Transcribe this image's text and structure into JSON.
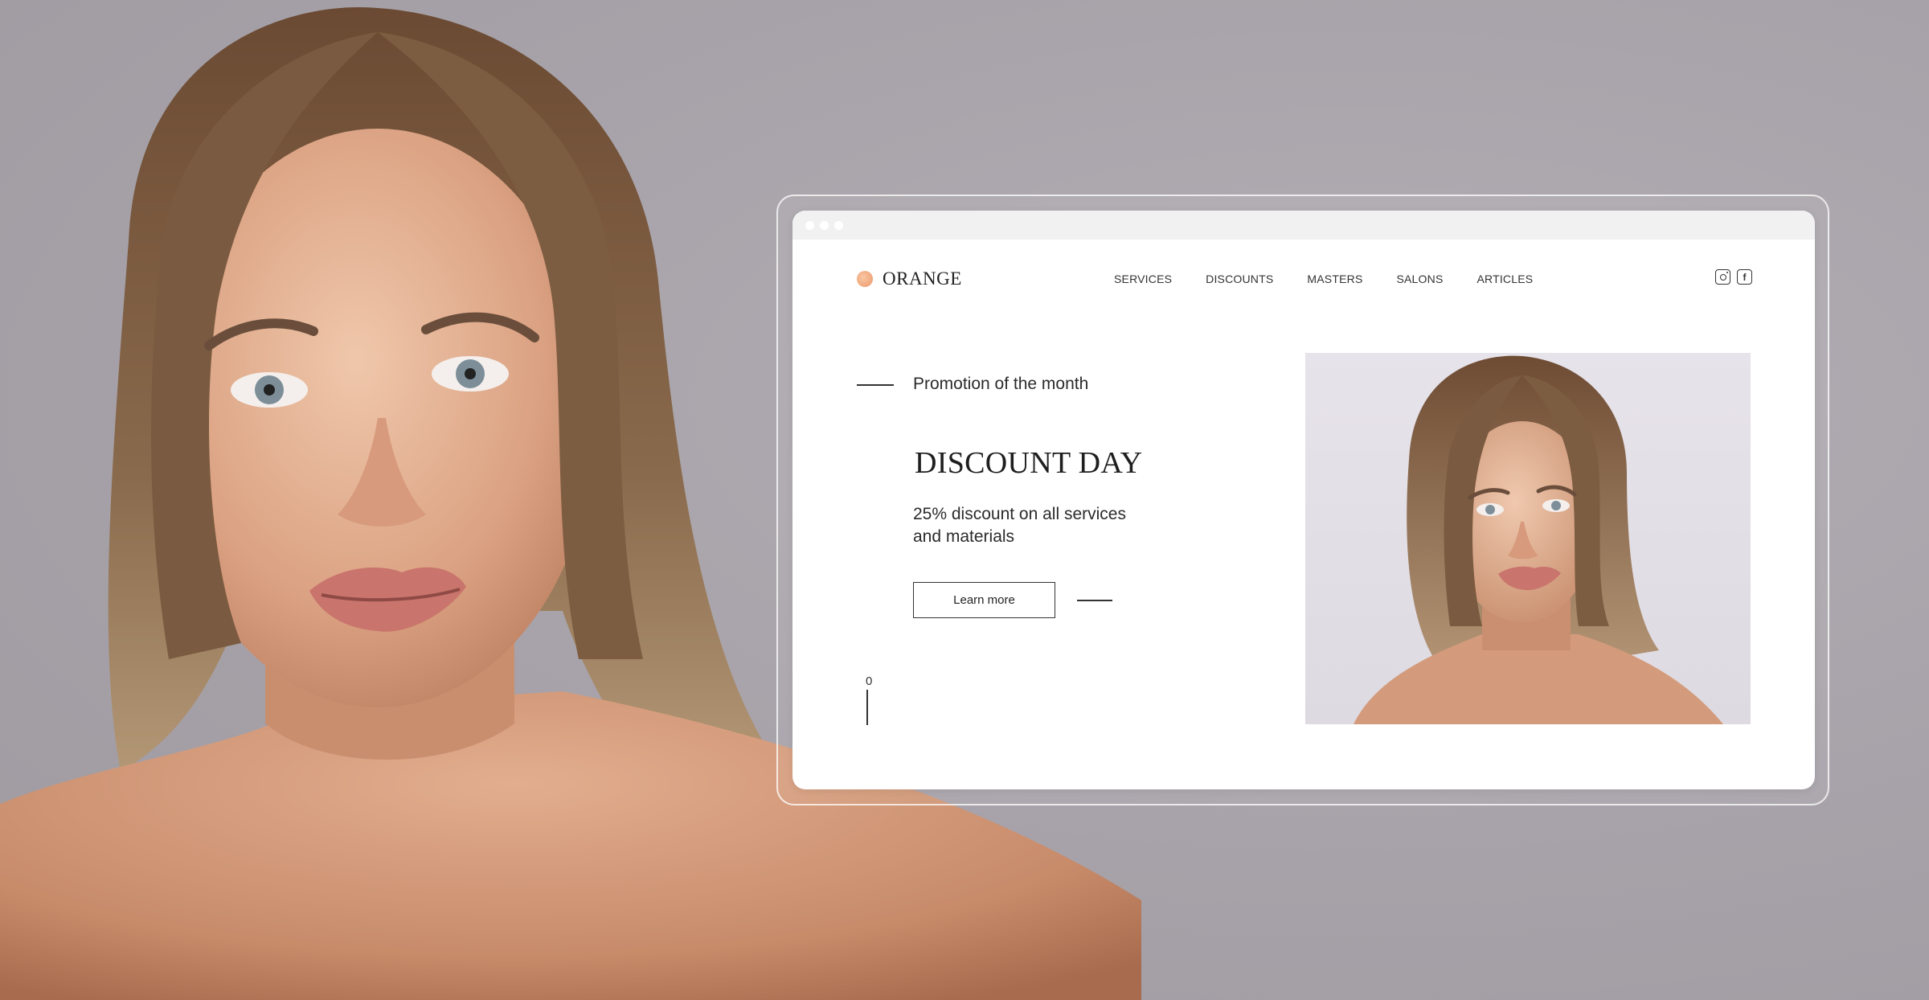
{
  "brand": {
    "name": "ORANGE",
    "accent_color": "#f0a67c"
  },
  "nav": {
    "items": [
      "SERVICES",
      "DISCOUNTS",
      "MASTERS",
      "SALONS",
      "ARTICLES"
    ]
  },
  "socials": {
    "instagram": "instagram-icon",
    "facebook": "f"
  },
  "hero": {
    "eyebrow": "Promotion of the month",
    "title": "DISCOUNT DAY",
    "description": "25% discount on all services and materials",
    "cta_label": "Learn more",
    "slide_number": "0"
  }
}
